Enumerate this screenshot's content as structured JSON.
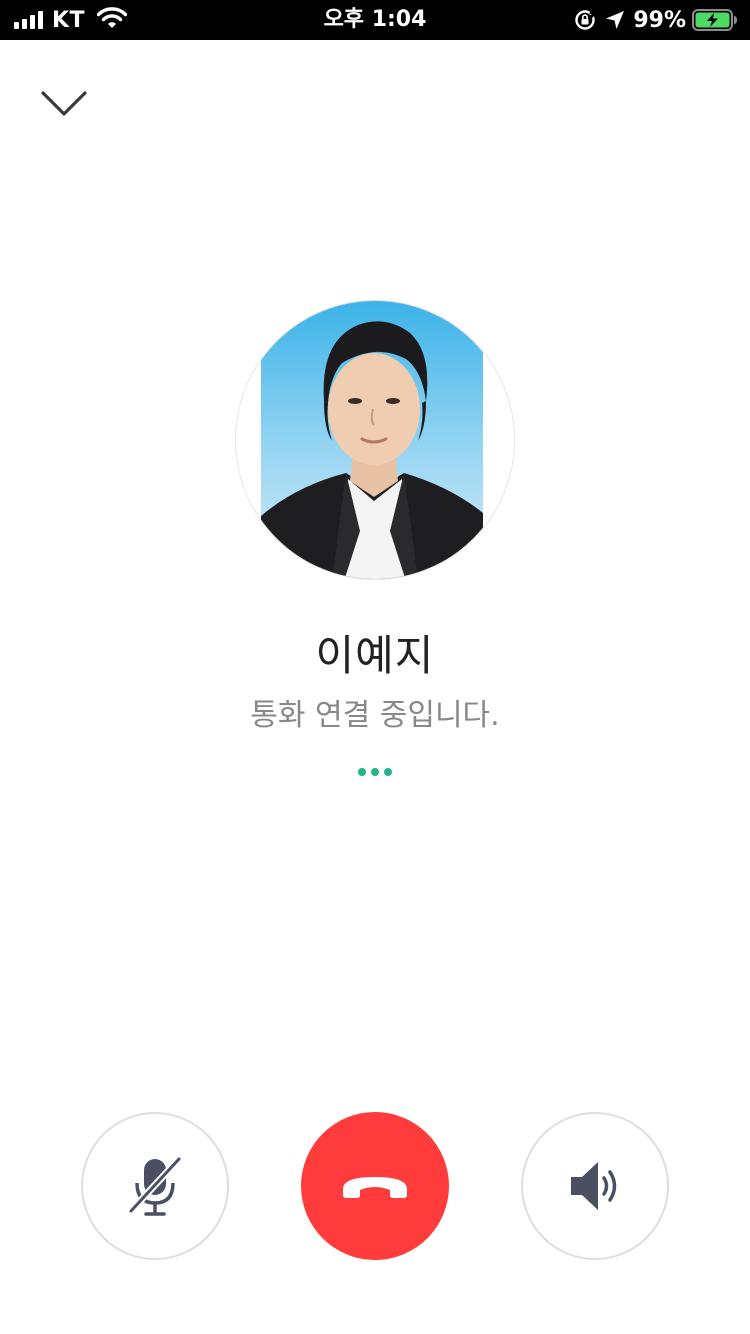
{
  "status_bar": {
    "carrier": "KT",
    "time": "오후 1:04",
    "battery_percent": "99%",
    "icons": [
      "signal-icon",
      "wifi-icon",
      "orientation-lock-icon",
      "location-arrow-icon",
      "battery-charging-icon"
    ]
  },
  "header": {
    "collapse_icon": "chevron-down-icon"
  },
  "caller": {
    "name": "이예지",
    "status": "통화 연결 중입니다."
  },
  "controls": {
    "mute_icon": "mic-off-icon",
    "hangup_icon": "phone-hangup-icon",
    "speaker_icon": "speaker-icon"
  },
  "colors": {
    "status_bar_bg": "#000000",
    "hangup_red": "#ff3b3b",
    "dots_green": "#1fb589",
    "icon_slate": "#4a5061",
    "battery_green": "#4cd964"
  }
}
